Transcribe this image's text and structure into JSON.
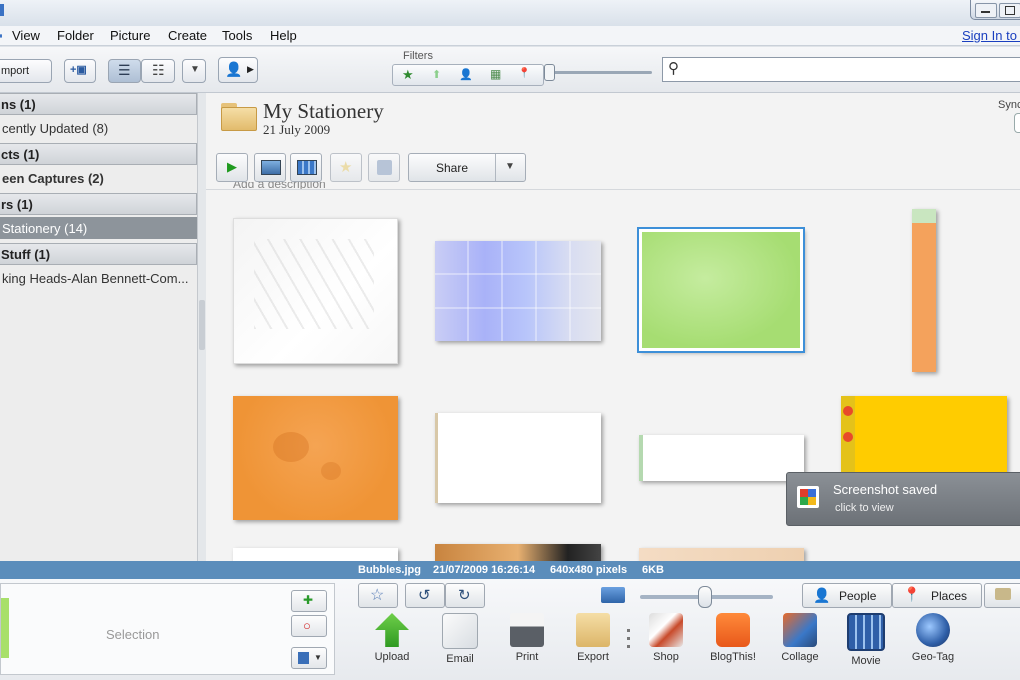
{
  "menu": {
    "items": [
      "View",
      "Folder",
      "Picture",
      "Create",
      "Tools",
      "Help"
    ],
    "sign_in": "Sign In to W"
  },
  "toolbar": {
    "import_label": "mport",
    "filters_label": "Filters",
    "filter_icons": [
      "★",
      "⬆",
      "👤",
      "▦",
      "📍"
    ]
  },
  "sidebar": {
    "rows": [
      {
        "type": "header",
        "label": "ns (1)"
      },
      {
        "type": "item",
        "label": "cently Updated (8)"
      },
      {
        "type": "header",
        "label": "cts (1)"
      },
      {
        "type": "item",
        "label": "een Captures (2)"
      },
      {
        "type": "header",
        "label": "rs (1)"
      },
      {
        "type": "item",
        "label": "Stationery (14)",
        "selected": true
      },
      {
        "type": "header",
        "label": "Stuff (1)"
      },
      {
        "type": "item",
        "label": "king Heads-Alan Bennett-Com..."
      }
    ]
  },
  "folder": {
    "title": "My Stationery",
    "date": "21 July 2009",
    "sync_label": "Sync",
    "description_placeholder": "Add a description",
    "share_label": "Share"
  },
  "toast": {
    "title": "Screenshot saved",
    "subtitle": "click to view"
  },
  "status": {
    "filename": "Bubbles.jpg",
    "datetime": "21/07/2009 16:26:14",
    "dimensions": "640x480 pixels",
    "size": "6KB"
  },
  "tray": {
    "selection_label": "Selection",
    "people_label": "People",
    "places_label": "Places",
    "tools": [
      "Upload",
      "Email",
      "Print",
      "Export",
      "Shop",
      "BlogThis!",
      "Collage",
      "Movie",
      "Geo-Tag"
    ]
  },
  "colors": {
    "accent": "#5b8dbb",
    "selected_row": "#8d949b",
    "link": "#1a3fbf"
  }
}
